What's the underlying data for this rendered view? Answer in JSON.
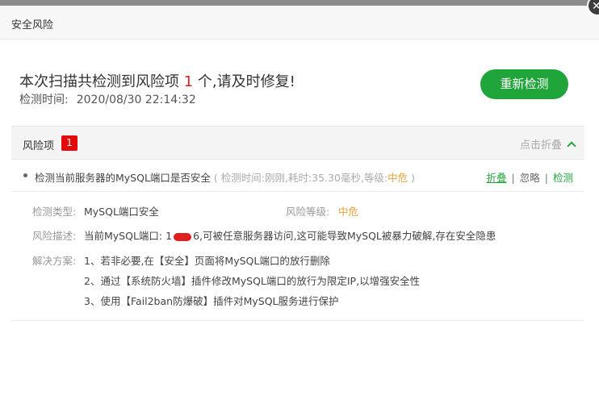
{
  "dialog": {
    "title": "安全风险",
    "close_icon": "close-icon"
  },
  "summary": {
    "prefix": "本次扫描共检测到风险项",
    "count": "1",
    "suffix": "个,请及时修复!",
    "time_label": "检测时间:",
    "time_value": "2020/08/30 22:14:32",
    "recheck_label": "重新检测"
  },
  "risk_section": {
    "title": "风险项",
    "badge": "1",
    "collapse_label": "点击折叠",
    "accent_color": "#20a53a",
    "badge_color": "#e50a0a"
  },
  "risk_item": {
    "title": "检测当前服务器的MySQL端口是否安全",
    "meta_prefix": "( 检测时间:刚刚,耗时:35.30毫秒,等级:",
    "level": "中危",
    "meta_suffix": ")",
    "actions": {
      "fold": "折叠",
      "ignore": "忽略",
      "check": "检测"
    }
  },
  "detail": {
    "type_label": "检测类型:",
    "type_value": "MySQL端口安全",
    "level_label": "风险等级:",
    "level_value": "中危",
    "desc_label": "风险描述:",
    "desc_prefix": "当前MySQL端口: 1",
    "desc_suffix": "6,可被任意服务器访问,这可能导致MySQL被暴力破解,存在安全隐患",
    "solution_label": "解决方案:",
    "solutions": [
      "1、若非必要,在【安全】页面将MySQL端口的放行删除",
      "2、通过【系统防火墙】插件修改MySQL端口的放行为限定IP,以增强安全性",
      "3、使用【Fail2ban防爆破】插件对MySQL服务进行保护"
    ]
  }
}
